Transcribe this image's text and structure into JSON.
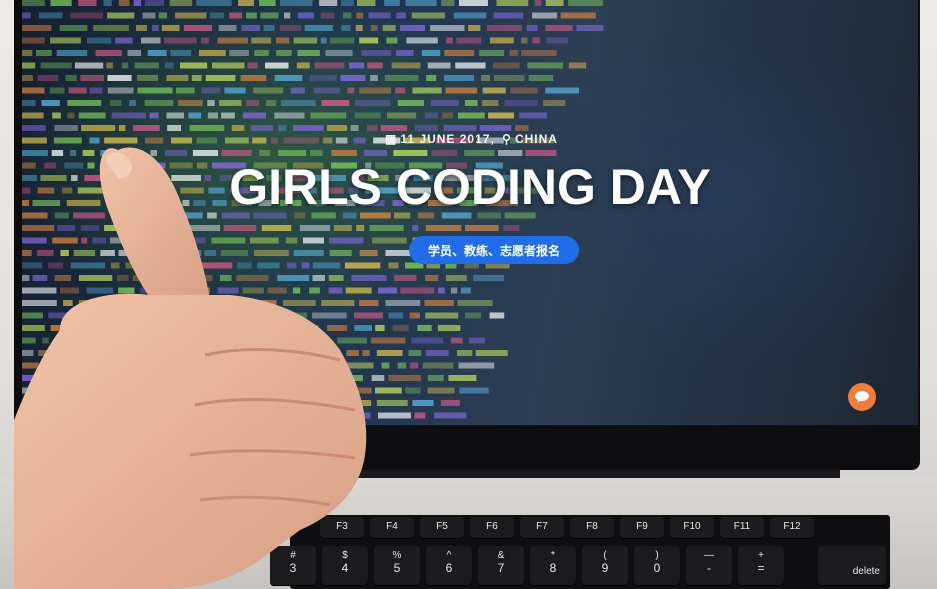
{
  "website": {
    "meta_date": "11 JUNE 2017,",
    "meta_location": "CHINA",
    "title": "GIRLS CODING DAY",
    "cta_label": "学员、教练、志愿者报名",
    "icons": [
      "calendar-icon",
      "location-pin-icon",
      "chat-bubble-icon"
    ]
  },
  "keyboard": {
    "function_row": [
      "F3",
      "F4",
      "F5",
      "F6",
      "F7",
      "F8",
      "F9",
      "F10",
      "F11",
      "F12"
    ],
    "number_row": [
      {
        "top": "#",
        "bot": "3"
      },
      {
        "top": "$",
        "bot": "4"
      },
      {
        "top": "%",
        "bot": "5"
      },
      {
        "top": "^",
        "bot": "6"
      },
      {
        "top": "&",
        "bot": "7"
      },
      {
        "top": "*",
        "bot": "8"
      },
      {
        "top": "(",
        "bot": "9"
      },
      {
        "top": ")",
        "bot": "0"
      },
      {
        "top": "—",
        "bot": "-"
      },
      {
        "top": "+",
        "bot": "="
      }
    ],
    "delete_label": "delete"
  },
  "colors": {
    "cta": "#1f6de8",
    "chat": "#f07b3a",
    "screen_bg": "#1d3350",
    "skin": "#e8b79a"
  }
}
